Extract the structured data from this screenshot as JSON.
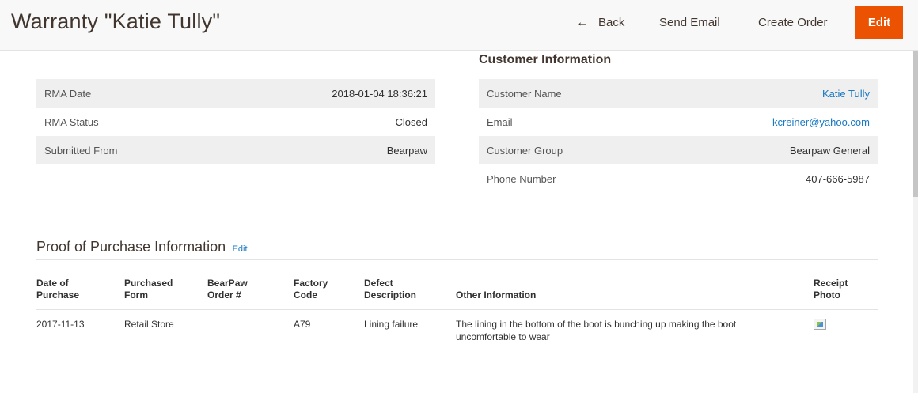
{
  "page": {
    "title": "Warranty \"Katie Tully\""
  },
  "actions": {
    "back": "Back",
    "send_email": "Send Email",
    "create_order": "Create Order",
    "edit": "Edit"
  },
  "rma": {
    "rows": [
      {
        "label": "RMA Date",
        "value": "2018-01-04 18:36:21"
      },
      {
        "label": "RMA Status",
        "value": "Closed"
      },
      {
        "label": "Submitted From",
        "value": "Bearpaw"
      }
    ]
  },
  "customer": {
    "heading": "Customer Information",
    "rows": [
      {
        "label": "Customer Name",
        "value": "Katie Tully"
      },
      {
        "label": "Email",
        "value": "kcreiner@yahoo.com"
      },
      {
        "label": "Customer Group",
        "value": "Bearpaw General"
      },
      {
        "label": "Phone Number",
        "value": "407-666-5987"
      }
    ]
  },
  "proof": {
    "heading": "Proof of Purchase Information",
    "edit_link": "Edit",
    "columns": [
      [
        "Date of",
        "Purchase"
      ],
      [
        "Purchased",
        "Form"
      ],
      [
        "BearPaw",
        "Order #"
      ],
      [
        "Factory",
        "Code"
      ],
      [
        "Defect",
        "Description"
      ],
      [
        "Other Information"
      ],
      [
        "Receipt",
        "Photo"
      ]
    ],
    "rows": [
      {
        "date": "2017-11-13",
        "form": "Retail Store",
        "order": "",
        "factory_code": "A79",
        "defect": "Lining failure",
        "other_line1": "The lining in the bottom of the boot is bunching up making the boot",
        "other_line2": "uncomfortable to wear"
      }
    ]
  },
  "colors": {
    "accent": "#eb5202",
    "link": "#1979c3",
    "row_shade": "#efefef"
  },
  "icons": {
    "back": "arrow-left-icon",
    "receipt": "broken-image-icon"
  }
}
